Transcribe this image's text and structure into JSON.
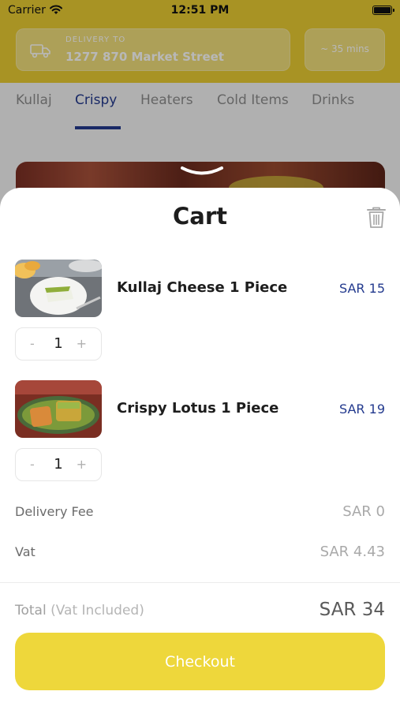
{
  "status_bar": {
    "carrier": "Carrier",
    "time": "12:51 PM"
  },
  "header": {
    "delivery_label": "DELIVERY TO",
    "delivery_address": "1277 870 Market Street",
    "eta": "~ 35 mins"
  },
  "tabs": [
    {
      "label": "Kullaj",
      "active": false
    },
    {
      "label": "Crispy",
      "active": true
    },
    {
      "label": "Heaters",
      "active": false
    },
    {
      "label": "Cold Items",
      "active": false
    },
    {
      "label": "Drinks",
      "active": false
    }
  ],
  "cart": {
    "title": "Cart",
    "items": [
      {
        "name": "Kullaj Cheese 1 Piece",
        "price": "SAR 15",
        "quantity": "1",
        "minus": "-",
        "plus": "+"
      },
      {
        "name": "Crispy Lotus 1 Piece",
        "price": "SAR 19",
        "quantity": "1",
        "minus": "-",
        "plus": "+"
      }
    ],
    "delivery_fee": {
      "label": "Delivery Fee",
      "value": "SAR 0"
    },
    "vat": {
      "label": "Vat",
      "value": "SAR 4.43"
    },
    "total": {
      "label": "Total",
      "note": "(Vat Included)",
      "value": "SAR 34"
    },
    "checkout_label": "Checkout"
  },
  "colors": {
    "brand_yellow": "#e9cc33",
    "checkout_yellow": "#eed73b",
    "accent_blue": "#233a8e"
  },
  "icons": [
    "wifi-icon",
    "battery-icon",
    "truck-icon",
    "trash-icon",
    "chevron-down-icon"
  ]
}
